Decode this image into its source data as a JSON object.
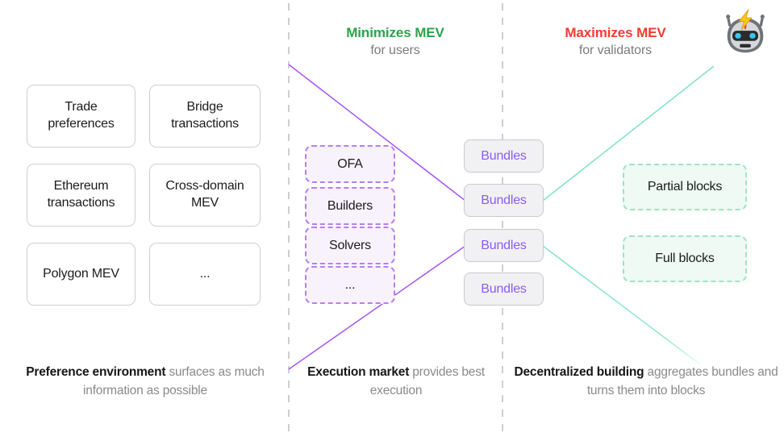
{
  "headers": {
    "minimizes": {
      "title": "Minimizes MEV",
      "subtitle": "for users",
      "color": "#2aa44c"
    },
    "maximizes": {
      "title": "Maximizes MEV",
      "subtitle": "for validators",
      "color": "#f23c30"
    }
  },
  "robot": {
    "name": "mev-robot-emoji",
    "alt": "robot face with lightning bolt"
  },
  "preference_environment": {
    "boxes": [
      {
        "label": "Trade preferences"
      },
      {
        "label": "Bridge transactions"
      },
      {
        "label": "Ethereum transactions"
      },
      {
        "label": "Cross-domain MEV"
      },
      {
        "label": "Polygon MEV"
      },
      {
        "label": "..."
      }
    ]
  },
  "execution_market": {
    "boxes": [
      {
        "label": "OFA"
      },
      {
        "label": "Builders"
      },
      {
        "label": "Solvers"
      },
      {
        "label": "..."
      }
    ]
  },
  "bundles": {
    "boxes": [
      {
        "label": "Bundles"
      },
      {
        "label": "Bundles"
      },
      {
        "label": "Bundles"
      },
      {
        "label": "Bundles"
      }
    ]
  },
  "decentralized_building": {
    "boxes": [
      {
        "label": "Partial blocks"
      },
      {
        "label": "Full blocks"
      }
    ]
  },
  "captions": {
    "left": {
      "bold": "Preference environment",
      "rest": " surfaces as much information as possible"
    },
    "middle": {
      "bold": "Execution market",
      "rest": " provides best execution"
    },
    "right": {
      "bold": "Decentralized building",
      "rest": " aggregates bundles and turns them into blocks"
    }
  },
  "colors": {
    "purple_line": "#a855f7",
    "green_line": "#7fe3c0",
    "divider": "#b9b9b9",
    "bundle_text": "#8b5cf6",
    "exec_border": "#b57ef0",
    "exec_fill": "#f8f2fd",
    "block_border": "#9fe3c4",
    "block_fill": "#eefaf3",
    "pref_border": "#cfcfcf",
    "subtitle": "#7b7b7b"
  }
}
